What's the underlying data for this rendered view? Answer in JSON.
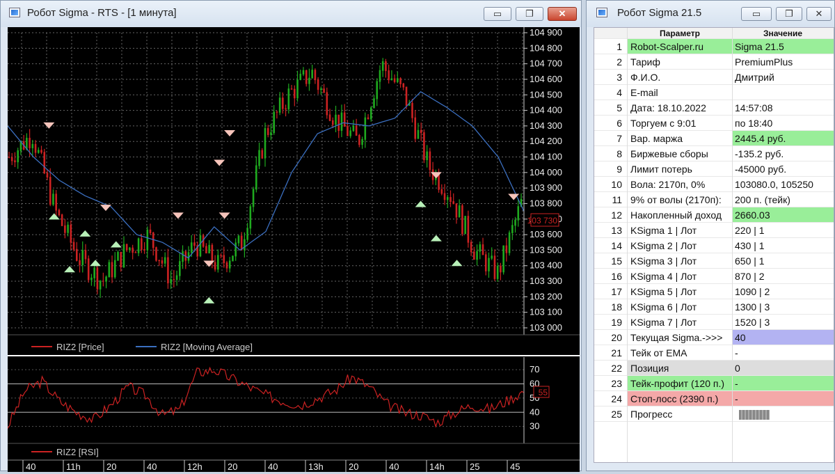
{
  "chart_window": {
    "title": "Робот Sigma - RTS   - [1 минута]",
    "buttons": {
      "minimize": "▭",
      "maximize": "❐",
      "close": "✕"
    }
  },
  "table_window": {
    "title": "Робот Sigma 21.5",
    "buttons": {
      "minimize": "▭",
      "maximize": "❐",
      "close": "✕"
    },
    "headers": {
      "param": "Параметр",
      "value": "Значение"
    },
    "rows": [
      {
        "n": "1",
        "param": "Robot-Scalper.ru",
        "value": "Sigma 21.5",
        "param_bg": "#99ee99",
        "value_bg": "#99ee99"
      },
      {
        "n": "2",
        "param": "Тариф",
        "value": "PremiumPlus"
      },
      {
        "n": "3",
        "param": "Ф.И.О.",
        "value": "Дмитрий"
      },
      {
        "n": "4",
        "param": "E-mail",
        "value": ""
      },
      {
        "n": "5",
        "param": "Дата: 18.10.2022",
        "value": "14:57:08"
      },
      {
        "n": "6",
        "param": "Торгуем с 9:01",
        "value": "по 18:40"
      },
      {
        "n": "7",
        "param": "Вар. маржа",
        "value": "2445.4 руб.",
        "value_bg": "#99ee99"
      },
      {
        "n": "8",
        "param": "Биржевые сборы",
        "value": "-135.2 руб."
      },
      {
        "n": "9",
        "param": "Лимит потерь",
        "value": "-45000 руб."
      },
      {
        "n": "10",
        "param": "Вола: 2170п, 0%",
        "value": "103080.0, 105250"
      },
      {
        "n": "11",
        "param": "9% от волы (2170п):",
        "value": "200 п. (тейк)"
      },
      {
        "n": "12",
        "param": "Накопленный доход",
        "value": "2660.03",
        "value_bg": "#99ee99"
      },
      {
        "n": "13",
        "param": "KSigma 1 | Лот",
        "value": "220 | 1"
      },
      {
        "n": "14",
        "param": "KSigma 2 | Лот",
        "value": "430 | 1"
      },
      {
        "n": "15",
        "param": "KSigma 3 | Лот",
        "value": "650 | 1"
      },
      {
        "n": "16",
        "param": "KSigma 4 | Лот",
        "value": "870 | 2"
      },
      {
        "n": "17",
        "param": "KSigma 5 | Лот",
        "value": "1090 | 2"
      },
      {
        "n": "18",
        "param": "KSigma 6 | Лот",
        "value": "1300 | 3"
      },
      {
        "n": "19",
        "param": "KSigma 7 | Лот",
        "value": "1520 | 3"
      },
      {
        "n": "20",
        "param": "Текущая Sigma.->>>",
        "value": "40",
        "value_bg": "#b3b3f2"
      },
      {
        "n": "21",
        "param": "Тейк от EMA",
        "value": " -"
      },
      {
        "n": "22",
        "param": "Позиция",
        "value": "0",
        "param_bg": "#dddddd",
        "value_bg": "#dddddd"
      },
      {
        "n": "23",
        "param": "Тейк-профит (120 п.)",
        "value": "-",
        "param_bg": "#99ee99",
        "value_bg": "#99ee99"
      },
      {
        "n": "24",
        "param": "Стоп-лосс (2390 п.)",
        "value": "-",
        "param_bg": "#f4a8a8",
        "value_bg": "#f4a8a8"
      },
      {
        "n": "25",
        "param": "Прогресс",
        "value": "",
        "progress": true
      }
    ]
  },
  "chart_data": [
    {
      "type": "line",
      "series": [
        {
          "name": "RIZ2 [Price]",
          "color": "#cc2222"
        },
        {
          "name": "RIZ2 [Moving Average]",
          "color": "#3b6fc0"
        }
      ],
      "ylim": [
        103000,
        104900
      ],
      "y_ticks": [
        "104 900",
        "104 800",
        "104 700",
        "104 600",
        "104 500",
        "104 400",
        "104 300",
        "104 200",
        "104 100",
        "104 000",
        "103 900",
        "103 800",
        "103 700",
        "103 600",
        "103 500",
        "103 400",
        "103 300",
        "103 200",
        "103 100",
        "103 000"
      ],
      "last_value": "103 730",
      "ma": [
        104300,
        104100,
        103950,
        103850,
        103780,
        103600,
        103550,
        103450,
        103650,
        103500,
        103620,
        104000,
        104250,
        104320,
        104300,
        104350,
        104520,
        104420,
        104300,
        104100,
        103750
      ],
      "price": [
        104100,
        104250,
        103750,
        103450,
        103300,
        103500,
        103600,
        103300,
        103550,
        103400,
        103550,
        104250,
        104500,
        104650,
        104350,
        104200,
        104700,
        104500,
        104050,
        103850,
        103500,
        103350,
        103800
      ],
      "sell_markers": [
        [
          0.08,
          104300
        ],
        [
          0.19,
          103770
        ],
        [
          0.33,
          103720
        ],
        [
          0.39,
          103410
        ],
        [
          0.41,
          104060
        ],
        [
          0.43,
          104250
        ],
        [
          0.42,
          103720
        ],
        [
          0.83,
          103980
        ],
        [
          0.98,
          103840
        ]
      ],
      "buy_markers": [
        [
          0.09,
          103720
        ],
        [
          0.12,
          103380
        ],
        [
          0.15,
          103610
        ],
        [
          0.17,
          103420
        ],
        [
          0.21,
          103540
        ],
        [
          0.39,
          103180
        ],
        [
          0.8,
          103800
        ],
        [
          0.83,
          103580
        ],
        [
          0.87,
          103420
        ]
      ]
    },
    {
      "type": "line",
      "series": [
        {
          "name": "RIZ2 [RSI]",
          "color": "#cc2222"
        }
      ],
      "ylim": [
        20,
        75
      ],
      "y_ticks": [
        "70",
        "60",
        "50",
        "40",
        "30"
      ],
      "last_value": "55",
      "rsi": [
        30,
        55,
        62,
        48,
        40,
        35,
        45,
        58,
        52,
        38,
        42,
        68,
        70,
        64,
        58,
        52,
        48,
        45,
        50,
        55,
        65,
        58,
        46,
        40,
        38,
        33,
        40,
        45,
        42,
        48,
        55
      ]
    }
  ],
  "time_axis": {
    "labels": [
      "40",
      "11h",
      "20",
      "40",
      "12h",
      "20",
      "40",
      "13h",
      "20",
      "40",
      "14h",
      "25",
      "45"
    ]
  }
}
